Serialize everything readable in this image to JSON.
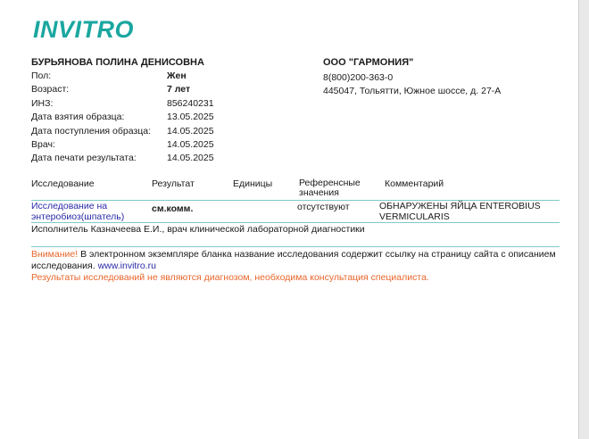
{
  "logo": "INVITRO",
  "patient": {
    "name": "БУРЬЯНОВА ПОЛИНА ДЕНИСОВНА",
    "fields": [
      {
        "label": "Пол:",
        "value": "Жен"
      },
      {
        "label": "Возраст:",
        "value": "7 лет"
      },
      {
        "label": "ИНЗ:",
        "value": "856240231"
      },
      {
        "label": "Дата взятия образца:",
        "value": "13.05.2025"
      },
      {
        "label": "Дата поступления образца:",
        "value": "14.05.2025"
      },
      {
        "label": "Врач:",
        "value": "14.05.2025"
      },
      {
        "label": "Дата печати результата:",
        "value": "14.05.2025"
      }
    ]
  },
  "org": {
    "name": "ООО \"ГАРМОНИЯ\"",
    "phone": "8(800)200-363-0",
    "address": "445047, Тольятти, Южное шоссе, д. 27-А"
  },
  "table": {
    "headers": {
      "study": "Исследование",
      "result": "Результат",
      "units": "Единицы",
      "reference_line1": "Референсные",
      "reference_line2": "значения",
      "comment": "Комментарий"
    },
    "row": {
      "study_line1": "Исследование на",
      "study_line2": "энтеробиоз(шпатель)",
      "result": "см.комм.",
      "units": "",
      "reference": "отсутствуют",
      "comment_line1": "ОБНАРУЖЕНЫ ЯЙЦА ENTEROBIUS",
      "comment_line2": "VERMICULARIS"
    }
  },
  "executor": "Исполнитель Казначеева  Е.И., врач клинической лабораторной диагностики",
  "notice": {
    "warning_word": "Внимание!",
    "text": " В электронном экземпляре бланка название исследования содержит ссылку на страницу сайта с описанием исследования. ",
    "link": "www.invitro.ru",
    "disclaimer": "Результаты исследований не являются диагнозом, необходима консультация специалиста."
  }
}
